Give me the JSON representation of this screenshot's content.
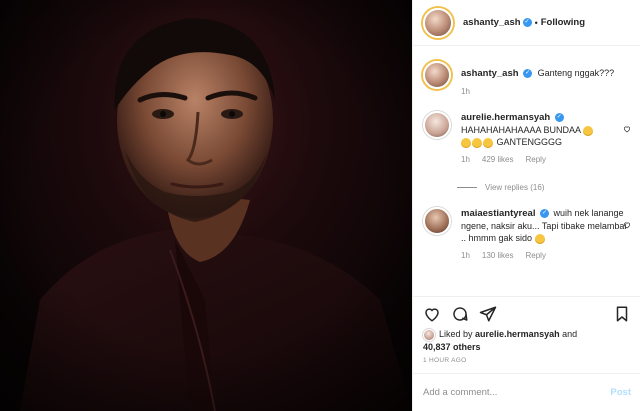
{
  "post": {
    "author": "ashanty_ash",
    "follow_status": "Following",
    "caption": "Ganteng nggak???",
    "caption_time": "1h",
    "time_ago": "1 HOUR AGO"
  },
  "comments": [
    {
      "username": "aurelie.hermansyah",
      "text_1": "HAHAHAHAHAAAA BUNDAA",
      "text_2": "GANTENGGGG",
      "time": "1h",
      "likes": "429 likes",
      "reply": "Reply",
      "view_replies": "View replies (16)"
    },
    {
      "username": "maiaestiantyreal",
      "text": "wuih nek lanange ngene, naksir aku... Tapi tibake melambai .. hmmm gak sido",
      "time": "1h",
      "likes": "130 likes",
      "reply": "Reply"
    }
  ],
  "likes": {
    "prefix": "Liked by",
    "by": "aurelie.hermansyah",
    "and": "and",
    "others": "40,837 others"
  },
  "add_comment": {
    "placeholder": "Add a comment...",
    "post_label": "Post"
  },
  "icons": [
    "heart-icon",
    "comment-icon",
    "share-icon",
    "bookmark-icon",
    "verified-icon",
    "more-icon"
  ],
  "colors": {
    "verified": "#3897f0",
    "muted": "#8e8e8e",
    "post_disabled": "#b2dffc"
  }
}
